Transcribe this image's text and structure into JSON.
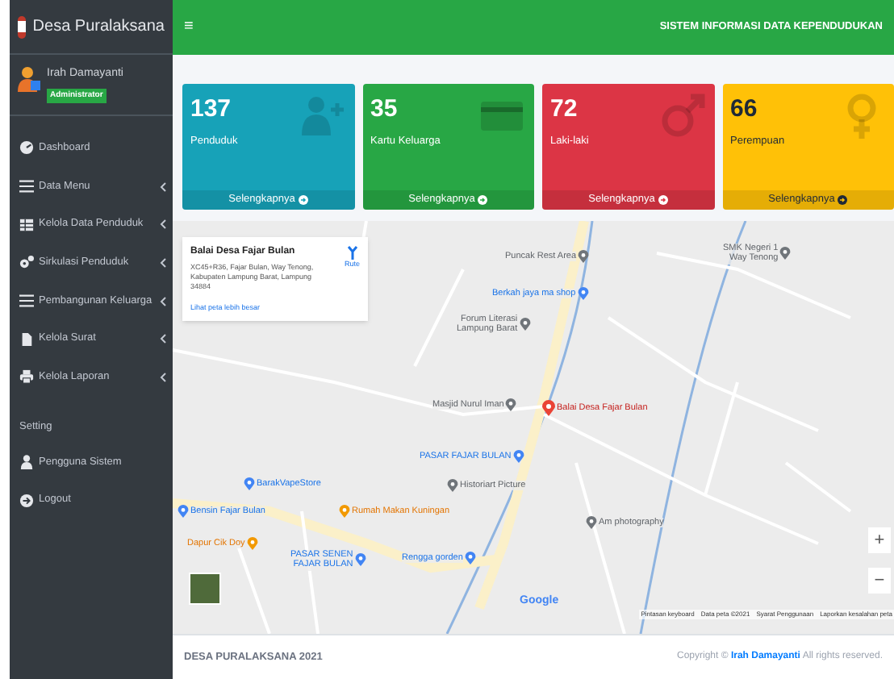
{
  "brand": {
    "title": "Desa Puralaksana"
  },
  "user": {
    "name": "Irah Damayanti",
    "role": "Administrator"
  },
  "sidebar": {
    "items": [
      {
        "label": "Dashboard",
        "kind": "dashboard",
        "has_submenu": false
      },
      {
        "label": "Data Menu",
        "kind": "list",
        "has_submenu": true
      },
      {
        "label": "Kelola Data Penduduk",
        "kind": "table",
        "has_submenu": true
      },
      {
        "label": "Sirkulasi Penduduk",
        "kind": "cogs",
        "has_submenu": true
      },
      {
        "label": "Pembangunan Keluarga",
        "kind": "list",
        "has_submenu": true
      },
      {
        "label": "Kelola Surat",
        "kind": "file",
        "has_submenu": true
      },
      {
        "label": "Kelola Laporan",
        "kind": "print",
        "has_submenu": true
      }
    ],
    "section": "Setting",
    "settings": [
      {
        "label": "Pengguna Sistem",
        "kind": "user",
        "has_submenu": false
      },
      {
        "label": "Logout",
        "kind": "logout",
        "has_submenu": false
      }
    ]
  },
  "header": {
    "menu_glyph": "≡",
    "title": "SISTEM INFORMASI DATA KEPENDUDUKAN"
  },
  "cards": [
    {
      "value": "137",
      "label": "Penduduk",
      "link": "Selengkapnya",
      "kind": "user-plus",
      "color": "#17a2b8"
    },
    {
      "value": "35",
      "label": "Kartu Keluarga",
      "link": "Selengkapnya",
      "kind": "card",
      "color": "#28a745"
    },
    {
      "value": "72",
      "label": "Laki-laki",
      "link": "Selengkapnya",
      "kind": "male",
      "color": "#dc3545"
    },
    {
      "value": "66",
      "label": "Perempuan",
      "link": "Selengkapnya",
      "kind": "female",
      "color": "#ffc107"
    }
  ],
  "map": {
    "info": {
      "title": "Balai Desa Fajar Bulan",
      "address": "XC45+R36, Fajar Bulan, Way Tenong, Kabupaten Lampung Barat, Lampung 34884",
      "directions": "Rute",
      "larger_map_link": "Lihat peta lebih besar"
    },
    "labels": [
      {
        "lines": [
          "Puncak Rest Area"
        ],
        "kind": "place"
      },
      {
        "lines": [
          "SMK Negeri 1",
          "Way Tenong"
        ],
        "kind": "place"
      },
      {
        "lines": [
          "Berkah jaya ma shop"
        ],
        "kind": "shop"
      },
      {
        "lines": [
          "Forum Literasi",
          "Lampung Barat"
        ],
        "kind": "place"
      },
      {
        "lines": [
          "Masjid Nurul Iman"
        ],
        "kind": "place"
      },
      {
        "lines": [
          "Balai Desa Fajar Bulan"
        ],
        "kind": "target"
      },
      {
        "lines": [
          "PASAR FAJAR BULAN"
        ],
        "kind": "shop"
      },
      {
        "lines": [
          "BarakVapeStore"
        ],
        "kind": "shop"
      },
      {
        "lines": [
          "Historiart Picture"
        ],
        "kind": "place"
      },
      {
        "lines": [
          "Bensin Fajar Bulan"
        ],
        "kind": "shop"
      },
      {
        "lines": [
          "Rumah Makan Kuningan"
        ],
        "kind": "food"
      },
      {
        "lines": [
          "Am photography"
        ],
        "kind": "place"
      },
      {
        "lines": [
          "Dapur Cik Doy"
        ],
        "kind": "food"
      },
      {
        "lines": [
          "PASAR SENEN",
          "FAJAR BULAN"
        ],
        "kind": "shop"
      },
      {
        "lines": [
          "Rengga gorden"
        ],
        "kind": "shop"
      }
    ],
    "zoom_in": "+",
    "zoom_out": "−",
    "google": "Google",
    "attribution": [
      "Pintasan keyboard",
      "Data peta ©2021",
      "Syarat Penggunaan",
      "Laporkan kesalahan peta"
    ]
  },
  "footer": {
    "left": "DESA PURALAKSANA 2021",
    "copyright_before": "Copyright ©",
    "author": "Irah Damayanti",
    "copyright_after": "All rights reserved."
  }
}
